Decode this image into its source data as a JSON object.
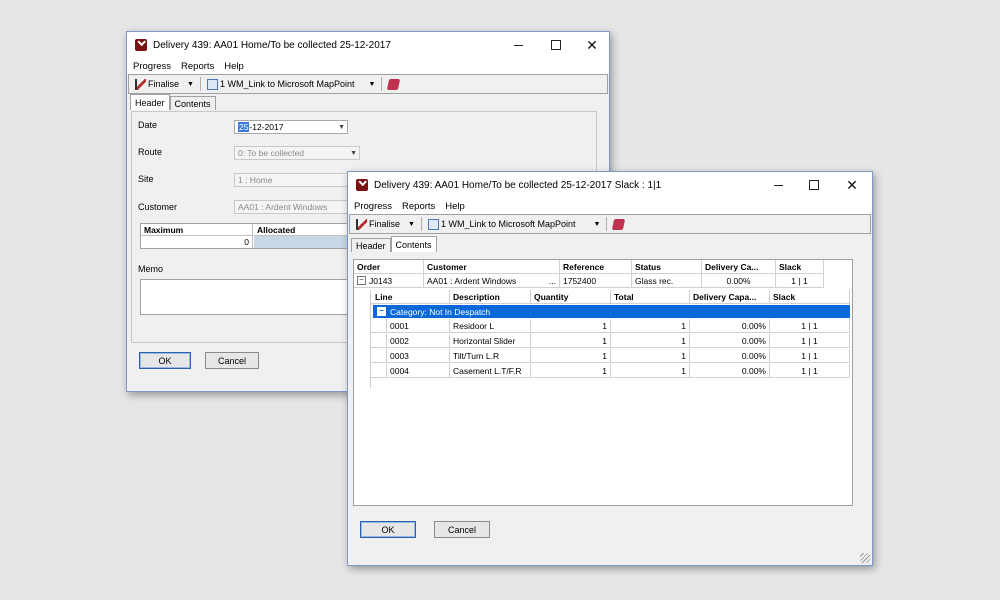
{
  "back_window": {
    "title": "Delivery 439: AA01  Home/To be collected 25-12-2017",
    "menu": [
      "Progress",
      "Reports",
      "Help"
    ],
    "toolbar": {
      "finalise": "Finalise",
      "mappoint": "1 WM_Link to Microsoft MapPoint"
    },
    "tabs": [
      "Header",
      "Contents"
    ],
    "fields": {
      "date_label": "Date",
      "date_sel": "25",
      "date_rest": "-12-2017",
      "route_label": "Route",
      "route_value": "0: To be collected",
      "site_label": "Site",
      "site_value": "1 : Home",
      "customer_label": "Customer",
      "customer_value": "AA01 : Ardent Windows",
      "memo_label": "Memo"
    },
    "alloc_table": {
      "col_max": "Maximum",
      "col_alloc": "Allocated",
      "max_value": "0"
    },
    "buttons": {
      "ok": "OK",
      "cancel": "Cancel"
    }
  },
  "front_window": {
    "title": "Delivery 439: AA01  Home/To be collected 25-12-2017  Slack : 1|1",
    "menu": [
      "Progress",
      "Reports",
      "Help"
    ],
    "toolbar": {
      "finalise": "Finalise",
      "mappoint": "1 WM_Link to Microsoft MapPoint"
    },
    "tabs": [
      "Header",
      "Contents"
    ],
    "order_headers": [
      "Order",
      "Customer",
      "Reference",
      "Status",
      "Delivery Ca...",
      "Slack"
    ],
    "order_row": {
      "expander": "−",
      "order": "J0143",
      "customer": "AA01    : Ardent Windows",
      "ellipsis": "...",
      "reference": "1752400",
      "status": "Glass rec.",
      "delivery": "0.00%",
      "slack": "1 | 1"
    },
    "line_headers": [
      "Line",
      "Description",
      "Quantity",
      "Total",
      "Delivery Capa...",
      "Slack"
    ],
    "category": "Category: Not In Despatch",
    "lines": [
      {
        "line": "0001",
        "description": "Residoor L",
        "quantity": "1",
        "total": "1",
        "delivery": "0.00%",
        "slack": "1 | 1"
      },
      {
        "line": "0002",
        "description": "Horizontal Slider",
        "quantity": "1",
        "total": "1",
        "delivery": "0.00%",
        "slack": "1 | 1"
      },
      {
        "line": "0003",
        "description": "Tilt/Turn L.R",
        "quantity": "1",
        "total": "1",
        "delivery": "0.00%",
        "slack": "1 | 1"
      },
      {
        "line": "0004",
        "description": "Casement L.T/F.R",
        "quantity": "1",
        "total": "1",
        "delivery": "0.00%",
        "slack": "1 | 1"
      }
    ],
    "buttons": {
      "ok": "OK",
      "cancel": "Cancel"
    }
  },
  "colors": {
    "selection": "#0a68d8",
    "window_border": "#7a9ac8",
    "background": "#e6e6e6"
  }
}
